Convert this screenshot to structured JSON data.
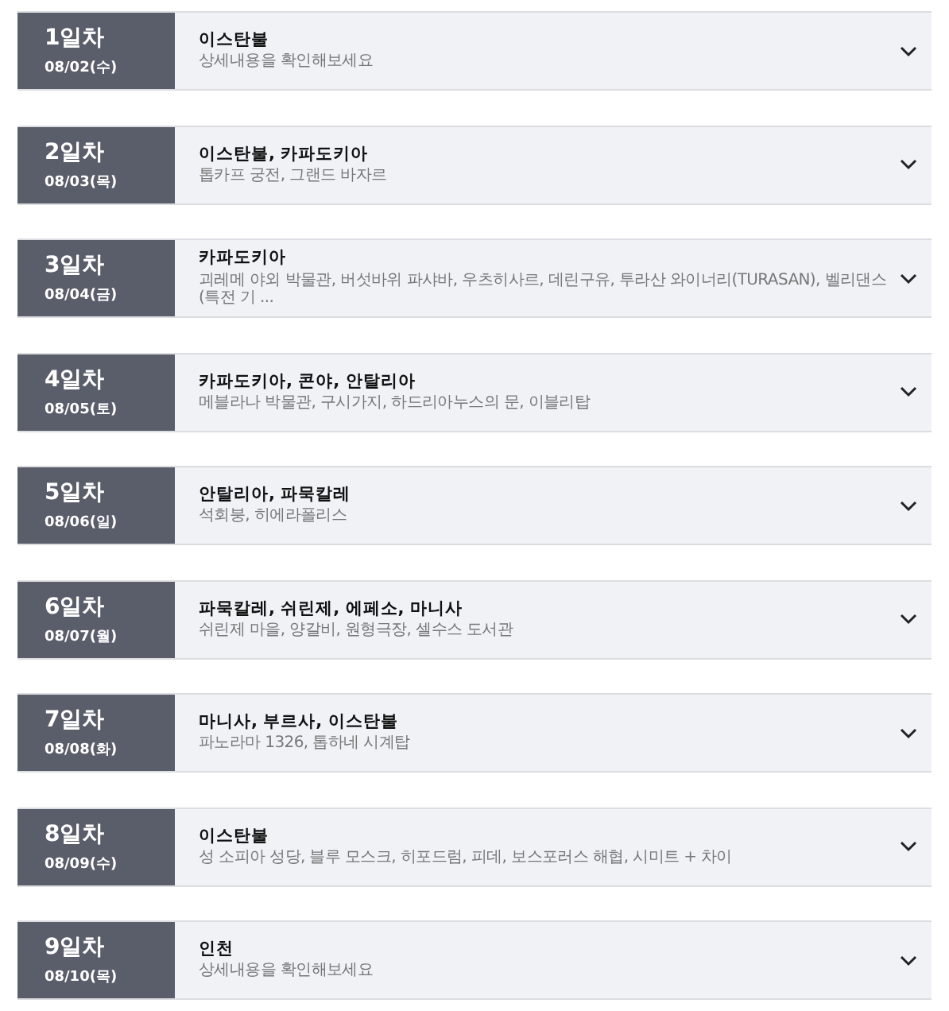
{
  "days": [
    {
      "day": "1일차",
      "date": "08/02(수)",
      "title": "이스탄불",
      "detail": "상세내용을 확인해보세요",
      "expanded": false
    },
    {
      "day": "2일차",
      "date": "08/03(목)",
      "title": "이스탄불, 카파도키아",
      "detail": "톱카프 궁전, 그랜드 바자르",
      "expanded": false
    },
    {
      "day": "3일차",
      "date": "08/04(금)",
      "title": "카파도키아",
      "detail": "괴레메 야외 박물관, 버섯바위 파샤바, 우츠히사르, 데린구유, 투라산 와이너리(TURASAN), 벨리댄스(특전 기 ...",
      "expanded": false
    },
    {
      "day": "4일차",
      "date": "08/05(토)",
      "title": "카파도키아, 콘야, 안탈리아",
      "detail": "메블라나 박물관, 구시가지, 하드리아누스의 문, 이블리탑",
      "expanded": false
    },
    {
      "day": "5일차",
      "date": "08/06(일)",
      "title": "안탈리아, 파묵칼레",
      "detail": "석회붕, 히에라폴리스",
      "expanded": false
    },
    {
      "day": "6일차",
      "date": "08/07(월)",
      "title": "파묵칼레, 쉬린제, 에페소, 마니사",
      "detail": "쉬린제 마을, 양갈비, 원형극장, 셀수스 도서관",
      "expanded": false
    },
    {
      "day": "7일차",
      "date": "08/08(화)",
      "title": "마니사, 부르사, 이스탄불",
      "detail": "파노라마 1326, 톱하네 시계탑",
      "expanded": false
    },
    {
      "day": "8일차",
      "date": "08/09(수)",
      "title": "이스탄불",
      "detail": "성 소피아 성당, 블루 모스크, 히포드럼, 피데, 보스포러스 해협, 시미트 + 차이",
      "expanded": false
    },
    {
      "day": "9일차",
      "date": "08/10(목)",
      "title": "인천",
      "detail": "상세내용을 확인해보세요",
      "expanded": false
    }
  ]
}
